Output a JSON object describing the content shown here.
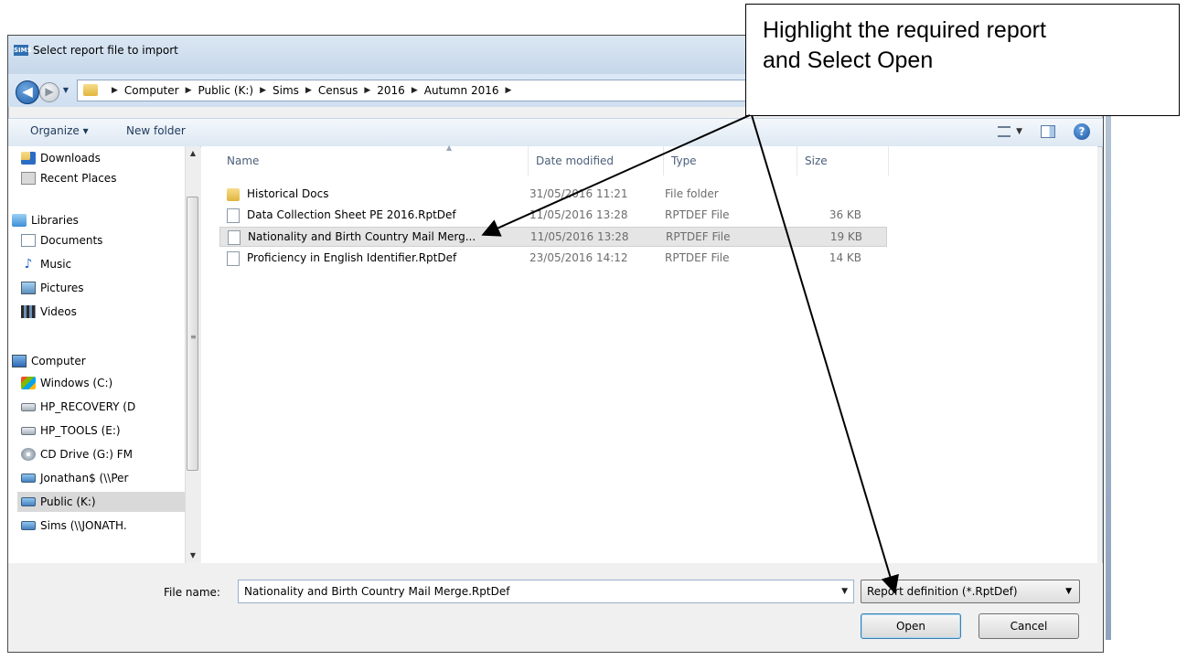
{
  "dialog": {
    "title": "Select report file to import",
    "app_badge": "SIMS"
  },
  "address": {
    "crumbs": [
      "Computer",
      "Public (K:)",
      "Sims",
      "Census",
      "2016",
      "Autumn 2016"
    ]
  },
  "toolbar": {
    "organize_label": "Organize ▾",
    "new_folder_label": "New folder"
  },
  "nav": {
    "items": [
      {
        "label": "Downloads",
        "icon": "downloads-icon"
      },
      {
        "label": "Recent Places",
        "icon": "recent-places-icon"
      },
      {
        "label": "Libraries",
        "icon": "libraries-icon"
      },
      {
        "label": "Documents",
        "icon": "documents-icon"
      },
      {
        "label": "Music",
        "icon": "music-icon"
      },
      {
        "label": "Pictures",
        "icon": "pictures-icon"
      },
      {
        "label": "Videos",
        "icon": "videos-icon"
      },
      {
        "label": "Computer",
        "icon": "computer-icon"
      },
      {
        "label": "Windows  (C:)",
        "icon": "windows-drive-icon"
      },
      {
        "label": "HP_RECOVERY (D",
        "icon": "drive-icon"
      },
      {
        "label": "HP_TOOLS (E:)",
        "icon": "drive-icon"
      },
      {
        "label": "CD Drive (G:) FM",
        "icon": "cd-drive-icon"
      },
      {
        "label": "Jonathan$ (\\\\Per",
        "icon": "network-drive-icon"
      },
      {
        "label": "Public (K:)",
        "icon": "network-drive-icon"
      },
      {
        "label": "Sims (\\\\JONATH.",
        "icon": "network-drive-icon"
      }
    ],
    "selected": "Public (K:)"
  },
  "files": {
    "columns": [
      "Name",
      "Date modified",
      "Type",
      "Size"
    ],
    "rows": [
      {
        "name": "Historical Docs",
        "date": "31/05/2016 11:21",
        "type": "File folder",
        "size": "",
        "kind": "folder"
      },
      {
        "name": "Data Collection Sheet PE 2016.RptDef",
        "date": "11/05/2016 13:28",
        "type": "RPTDEF File",
        "size": "36 KB",
        "kind": "file"
      },
      {
        "name": "Nationality and Birth Country Mail Merg...",
        "date": "11/05/2016 13:28",
        "type": "RPTDEF File",
        "size": "19 KB",
        "kind": "file"
      },
      {
        "name": "Proficiency in English Identifier.RptDef",
        "date": "23/05/2016 14:12",
        "type": "RPTDEF File",
        "size": "14 KB",
        "kind": "file"
      }
    ],
    "highlighted": "Nationality and Birth Country Mail Merg..."
  },
  "footer": {
    "file_name_label": "File name:",
    "file_name_value": "Nationality and Birth Country Mail Merge.RptDef",
    "file_type": "Report definition (*.RptDef)",
    "open_label": "Open",
    "cancel_label": "Cancel"
  },
  "callout": {
    "line1": "Highlight the required report",
    "line2": "and Select Open"
  }
}
